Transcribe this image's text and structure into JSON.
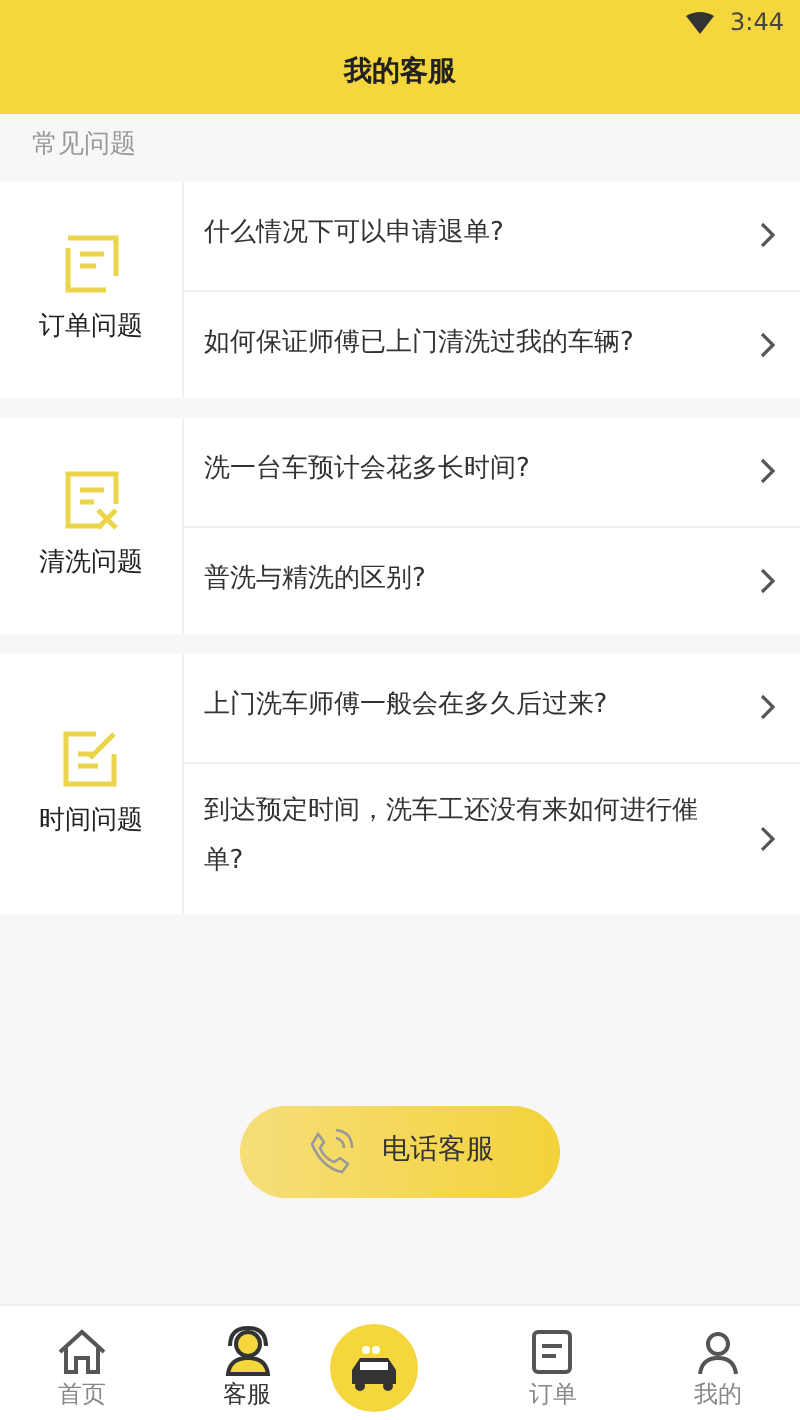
{
  "status_bar": {
    "time": "3:44"
  },
  "header": {
    "title": "我的客服"
  },
  "section_label": "常见问题",
  "groups": [
    {
      "kind": "order",
      "label": "订单问题",
      "questions": [
        "什么情况下可以申请退单?",
        "如何保证师傅已上门清洗过我的车辆?"
      ]
    },
    {
      "kind": "wash",
      "label": "清洗问题",
      "questions": [
        "洗一台车预计会花多长时间?",
        "普洗与精洗的区别?"
      ]
    },
    {
      "kind": "time",
      "label": "时间问题",
      "questions": [
        "上门洗车师傅一般会在多久后过来?",
        "到达预定时间，洗车工还没有来如何进行催单?"
      ]
    }
  ],
  "phone_button": {
    "label": "电话客服"
  },
  "tabs": [
    {
      "kind": "home",
      "label": "首页",
      "selected": false
    },
    {
      "kind": "service",
      "label": "客服",
      "selected": true
    },
    {
      "kind": "car",
      "selected": false
    },
    {
      "kind": "order",
      "label": "订单",
      "selected": false
    },
    {
      "kind": "me",
      "label": "我的",
      "selected": false
    }
  ]
}
